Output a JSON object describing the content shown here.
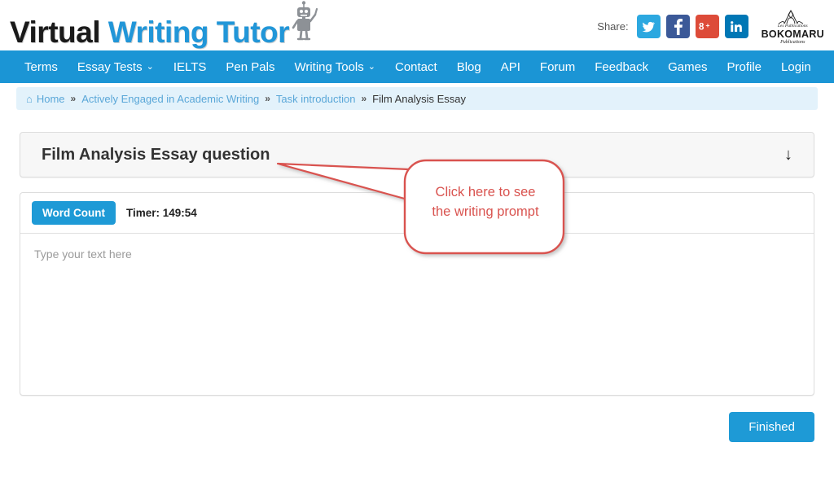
{
  "header": {
    "logo": {
      "part1": "Virtual",
      "part2": "Writing",
      "part3": "Tutor",
      "robot_icon": "robot-icon"
    },
    "share_label": "Share:",
    "share_buttons": [
      {
        "name": "twitter",
        "glyph": "🐦",
        "color": "#2ca8e0"
      },
      {
        "name": "facebook",
        "glyph": "f",
        "color": "#3b5998"
      },
      {
        "name": "google-plus",
        "glyph": "8+",
        "color": "#dd4b39"
      },
      {
        "name": "linkedin",
        "glyph": "in",
        "color": "#0077b5"
      }
    ],
    "publisher": {
      "line1": "Les Publications",
      "line2": "BOKOMARU",
      "line3": "Publications"
    }
  },
  "nav": {
    "accent_color": "#1b95d5",
    "items": [
      {
        "label": "Terms",
        "dropdown": false
      },
      {
        "label": "Essay Tests",
        "dropdown": true
      },
      {
        "label": "IELTS",
        "dropdown": false
      },
      {
        "label": "Pen Pals",
        "dropdown": false
      },
      {
        "label": "Writing Tools",
        "dropdown": true
      },
      {
        "label": "Contact",
        "dropdown": false
      },
      {
        "label": "Blog",
        "dropdown": false
      },
      {
        "label": "API",
        "dropdown": false
      },
      {
        "label": "Forum",
        "dropdown": false
      },
      {
        "label": "Feedback",
        "dropdown": false
      },
      {
        "label": "Games",
        "dropdown": false
      },
      {
        "label": "Profile",
        "dropdown": false
      },
      {
        "label": "Login",
        "dropdown": false
      }
    ]
  },
  "breadcrumb": {
    "home": "Home",
    "separator": "»",
    "items": [
      "Actively Engaged in Academic Writing",
      "Task introduction"
    ],
    "current": "Film Analysis Essay"
  },
  "question_panel": {
    "title": "Film Analysis Essay question",
    "toggle_icon": "arrow-down-icon",
    "toggle_glyph": "↓"
  },
  "editor": {
    "word_count_label": "Word Count",
    "timer_label": "Timer: 149:54",
    "placeholder": "Type your text here",
    "value": ""
  },
  "footer": {
    "finished_label": "Finished"
  },
  "annotation": {
    "line1": "Click here to see",
    "line2": "the writing prompt",
    "color": "#d9534f"
  }
}
